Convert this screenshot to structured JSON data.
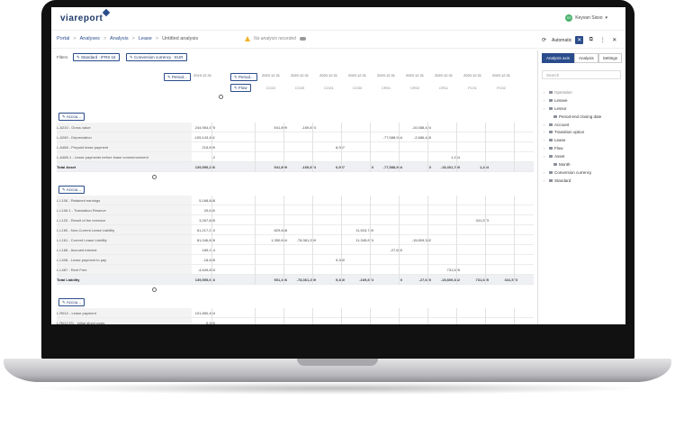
{
  "app": {
    "logo": "viareport",
    "user_initials": "KS",
    "user_name": "Keyvan Sisso",
    "user_menu_caret": "▾"
  },
  "breadcrumb": [
    "Portal",
    "Analyses",
    "Analysis",
    "Lease",
    "Untitled analysis"
  ],
  "warning": "No analysis recorded",
  "toolbar": {
    "automatic_label": "Automatic",
    "collapse_glyph": "✕",
    "copy_glyph": "⧉",
    "menu_glyph": "⋮",
    "close_glyph": "✕"
  },
  "filters": {
    "label": "Filters",
    "chips": [
      "Standard : IFRS 16",
      "Conversion currency : EUR"
    ]
  },
  "pivot": {
    "period_label": "Period...",
    "period_label2": "Period...",
    "flow_label": "Flow",
    "first_col_date": "2019.12.31",
    "col_dates": [
      "2020.12.31",
      "2020.12.31",
      "2020.12.31",
      "2020.12.31",
      "2020.12.31",
      "2020.12.31",
      "2020.12.31",
      "2020.12.31",
      "2020.12.31"
    ],
    "col_codes": [
      "CO22",
      "CO23",
      "CO24",
      "CO33",
      "CR01",
      "CR02",
      "CR11",
      "FC01",
      "FC02"
    ]
  },
  "sections": [
    {
      "button": "Accou...",
      "rows": [
        {
          "label": "L.A210 - Gross value",
          "values": [
            "244,954,475",
            "",
            "541,899",
            "-169,874",
            "",
            "",
            "",
            "-10,088,424",
            "",
            ""
          ]
        },
        {
          "label": "L.A260 - Depreciation",
          "values": [
            "-105,143,451",
            "",
            "",
            "",
            "",
            "",
            "-77,588,944",
            "-2,686,445",
            "",
            ""
          ]
        },
        {
          "label": "L.A488 - Prepaid lease payment",
          "values": [
            "215,699",
            "",
            "",
            "",
            "6,957",
            "",
            "",
            "",
            "",
            ""
          ]
        },
        {
          "label": "L.A488-1 - Lease payments before lease commencement",
          "values": [
            "12",
            "",
            "",
            "",
            "",
            "",
            "",
            "",
            "1,244",
            ""
          ]
        },
        {
          "label": "Total Asset",
          "values": [
            "139,595,236",
            "",
            "541,899",
            "-169,874",
            "6,957",
            "0",
            "-77,588,944",
            "0",
            "-15,401,780",
            "1,244"
          ],
          "total": true
        }
      ]
    },
    {
      "button": "Accou...",
      "rows": [
        {
          "label": "L.L106 - Retained earnings",
          "values": [
            "5,168,888",
            "",
            "",
            "",
            "",
            "",
            "",
            "",
            "",
            ""
          ]
        },
        {
          "label": "L.L106.1 - Translation Reserve",
          "values": [
            "29,630",
            "",
            "",
            "",
            "",
            "",
            "",
            "",
            "",
            ""
          ]
        },
        {
          "label": "L.L120 - Result of the exercice",
          "values": [
            "3,267,885",
            "",
            "",
            "",
            "",
            "",
            "",
            "",
            "",
            "341,573"
          ]
        },
        {
          "label": "L.L160 - Non-Current Lease Liability",
          "values": [
            "61,217,210",
            "",
            "829,688",
            "",
            "",
            "11,515,749",
            "",
            "",
            "",
            ""
          ]
        },
        {
          "label": "L.L161 - Current Lease Liability",
          "values": [
            "81,046,826",
            "",
            "1,350,694",
            "-78,361,259",
            "",
            "11,345,874",
            "",
            "-15,809,382",
            "",
            ""
          ]
        },
        {
          "label": "L.L168 - Accrued interest",
          "values": [
            "189,214",
            "",
            "",
            "",
            "",
            "",
            "-27,620",
            "",
            "",
            ""
          ]
        },
        {
          "label": "L.L408 - Lease payment to pay",
          "values": [
            "-18,585",
            "",
            "",
            "",
            "9,380",
            "",
            "",
            "",
            "",
            ""
          ]
        },
        {
          "label": "L.L487 - Rent Free",
          "values": [
            "-4,649,853",
            "",
            "",
            "",
            "",
            "",
            "",
            "",
            "731,625",
            ""
          ]
        },
        {
          "label": "Total Liability",
          "values": [
            "139,595,016",
            "",
            "501,106",
            "-78,361,259",
            "9,380",
            "-169,874",
            "0",
            "-27,620",
            "-15,809,382",
            "731,625",
            "341,573"
          ],
          "total": true
        }
      ]
    },
    {
      "button": "Accou...",
      "rows": [
        {
          "label": "L.R612 - Lease payment",
          "values": [
            "101,850,494",
            "",
            "",
            "",
            "",
            "",
            "",
            "",
            "",
            ""
          ]
        },
        {
          "label": "L.R612.R1 - Initial direct costs",
          "values": [
            "5,000",
            "",
            "",
            "",
            "",
            "",
            "",
            "",
            "",
            ""
          ]
        }
      ]
    }
  ],
  "panel": {
    "tabs": [
      "Analysis axis",
      "Analysis",
      "Settings"
    ],
    "search_placeholder": "Search",
    "tree": [
      {
        "label": "Operation",
        "muted": true,
        "chev": "›"
      },
      {
        "label": "Lessee",
        "chev": "›"
      },
      {
        "label": "Lessor",
        "chev": "›"
      },
      {
        "label": "Period-end closing date",
        "chev": ""
      },
      {
        "label": "Account",
        "chev": "›"
      },
      {
        "label": "Transition option",
        "chev": "›"
      },
      {
        "label": "Lease",
        "chev": "›"
      },
      {
        "label": "Flow",
        "chev": "›"
      },
      {
        "label": "Asset",
        "chev": "›"
      },
      {
        "label": "Month",
        "chev": ""
      },
      {
        "label": "Conversion currency",
        "chev": "›"
      },
      {
        "label": "Standard",
        "chev": "›"
      }
    ]
  }
}
